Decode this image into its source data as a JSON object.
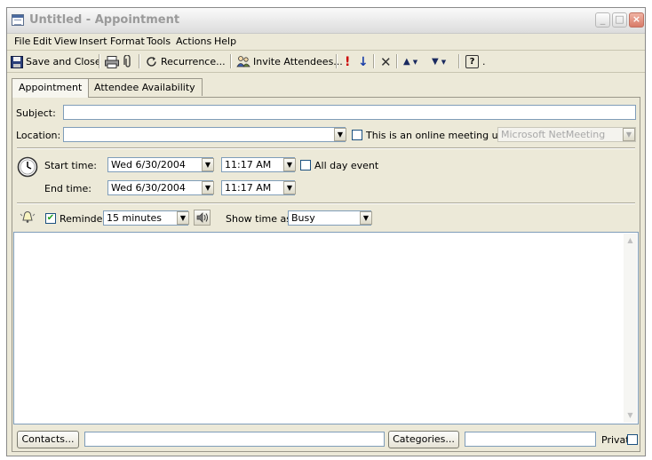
{
  "window": {
    "title": "Untitled - Appointment",
    "controls": {
      "minimize": "_",
      "maximize": "□",
      "close": "×"
    }
  },
  "menu": [
    "File",
    "Edit",
    "View",
    "Insert",
    "Format",
    "Tools",
    "Actions",
    "Help"
  ],
  "toolbar": {
    "save_close": "Save and Close",
    "recurrence": "Recurrence...",
    "invite": "Invite Attendees...",
    "importance_high": "!",
    "importance_low": "↓",
    "delete": "✕",
    "previous": "▲",
    "next": "▼",
    "help": "?"
  },
  "tabs": [
    "Appointment",
    "Attendee Availability"
  ],
  "form": {
    "subject_label": "Subject:",
    "subject_value": "",
    "location_label": "Location:",
    "location_value": "",
    "online_meeting_label": "This is an online meeting using:",
    "online_meeting_checked": false,
    "online_meeting_value": "Microsoft NetMeeting",
    "start_label": "Start time:",
    "start_date": "Wed 6/30/2004",
    "start_time": "11:17 AM",
    "allday_label": "All day event",
    "allday_checked": false,
    "end_label": "End time:",
    "end_date": "Wed 6/30/2004",
    "end_time": "11:17 AM",
    "reminder_label": "Reminder:",
    "reminder_checked": true,
    "reminder_value": "15 minutes",
    "show_as_label": "Show time as:",
    "show_as_value": "Busy",
    "notes": ""
  },
  "footer": {
    "contacts_button": "Contacts...",
    "contacts_value": "",
    "categories_button": "Categories...",
    "categories_value": "",
    "private_label": "Private",
    "private_checked": false
  },
  "icons": {
    "check_mark": "✔",
    "dropdown_arrow": "▼",
    "scroll_up": "▲",
    "scroll_down": "▼",
    "save": "floppy-disk-icon",
    "print": "printer-icon",
    "attach": "paperclip-icon",
    "recurrence": "recurrence-arrows-icon",
    "invite": "people-icon",
    "clock": "clock-icon",
    "bell": "reminder-bell-icon",
    "sound": "speaker-icon"
  },
  "colors": {
    "chrome": "#ece9d8",
    "importance_high": "#cc0000",
    "importance_low": "#1a3fa8",
    "field_border": "#7f9db9"
  }
}
